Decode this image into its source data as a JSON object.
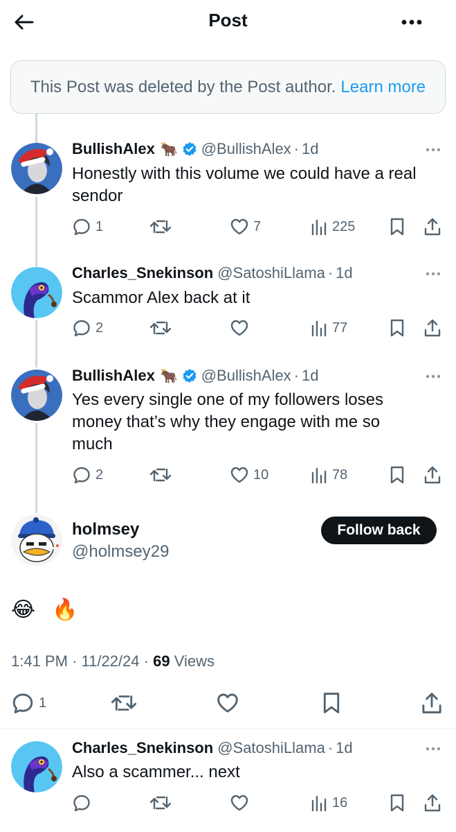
{
  "header": {
    "title": "Post"
  },
  "deleted_notice": {
    "text": "This Post was deleted by the Post author.",
    "link": "Learn more"
  },
  "replies": [
    {
      "name": "BullishAlex",
      "emoji": "🐂",
      "verified": true,
      "handle": "@BullishAlex",
      "time": "1d",
      "text": "Honestly with this volume we could have a real sendor",
      "replies": "1",
      "reposts": "",
      "likes": "7",
      "views": "225"
    },
    {
      "name": "Charles_Snekinson",
      "handle": "@SatoshiLlama",
      "time": "1d",
      "text": "Scammor Alex back at it",
      "replies": "2",
      "reposts": "",
      "likes": "",
      "views": "77"
    },
    {
      "name": "BullishAlex",
      "emoji": "🐂",
      "verified": true,
      "handle": "@BullishAlex",
      "time": "1d",
      "text": "Yes every single one of my followers loses money that’s why they engage with me so much",
      "replies": "2",
      "reposts": "",
      "likes": "10",
      "views": "78"
    }
  ],
  "main_post": {
    "name": "holmsey",
    "handle": "@holmsey29",
    "follow_label": "Follow back",
    "content": "😂 🔥",
    "time": "1:41 PM",
    "date": "11/22/24",
    "views_count": "69",
    "views_label": "Views",
    "replies": "1"
  },
  "bottom_reply": {
    "name": "Charles_Snekinson",
    "handle": "@SatoshiLlama",
    "time": "1d",
    "text": "Also a scammer... next",
    "replies": "",
    "reposts": "",
    "likes": "",
    "views": "16"
  },
  "colors": {
    "accent": "#1d9bf0",
    "text": "#0f1419",
    "secondary": "#536471",
    "border": "#cfd9de"
  }
}
